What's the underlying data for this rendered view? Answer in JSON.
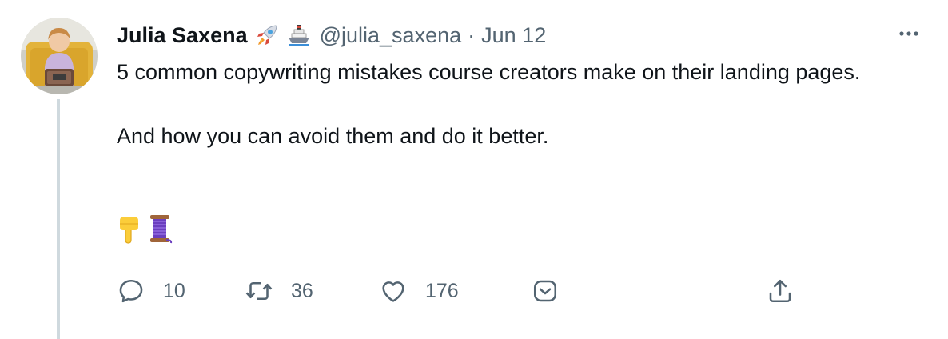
{
  "author": {
    "display_name": "Julia Saxena",
    "name_emojis": [
      "rocket-emoji",
      "ship-emoji"
    ],
    "handle": "@julia_saxena",
    "separator": "·",
    "date": "Jun 12"
  },
  "tweet": {
    "lines": [
      "5 common copywriting mistakes course creators make on their landing pages.",
      "And how you can avoid them and do it better."
    ],
    "emojis": [
      "backhand-index-pointing-down-emoji",
      "thread-spool-emoji"
    ]
  },
  "actions": {
    "reply_count": "10",
    "retweet_count": "36",
    "like_count": "176"
  },
  "colors": {
    "text": "#0f1419",
    "secondary": "#536471",
    "thread_line": "#cfd9de"
  }
}
